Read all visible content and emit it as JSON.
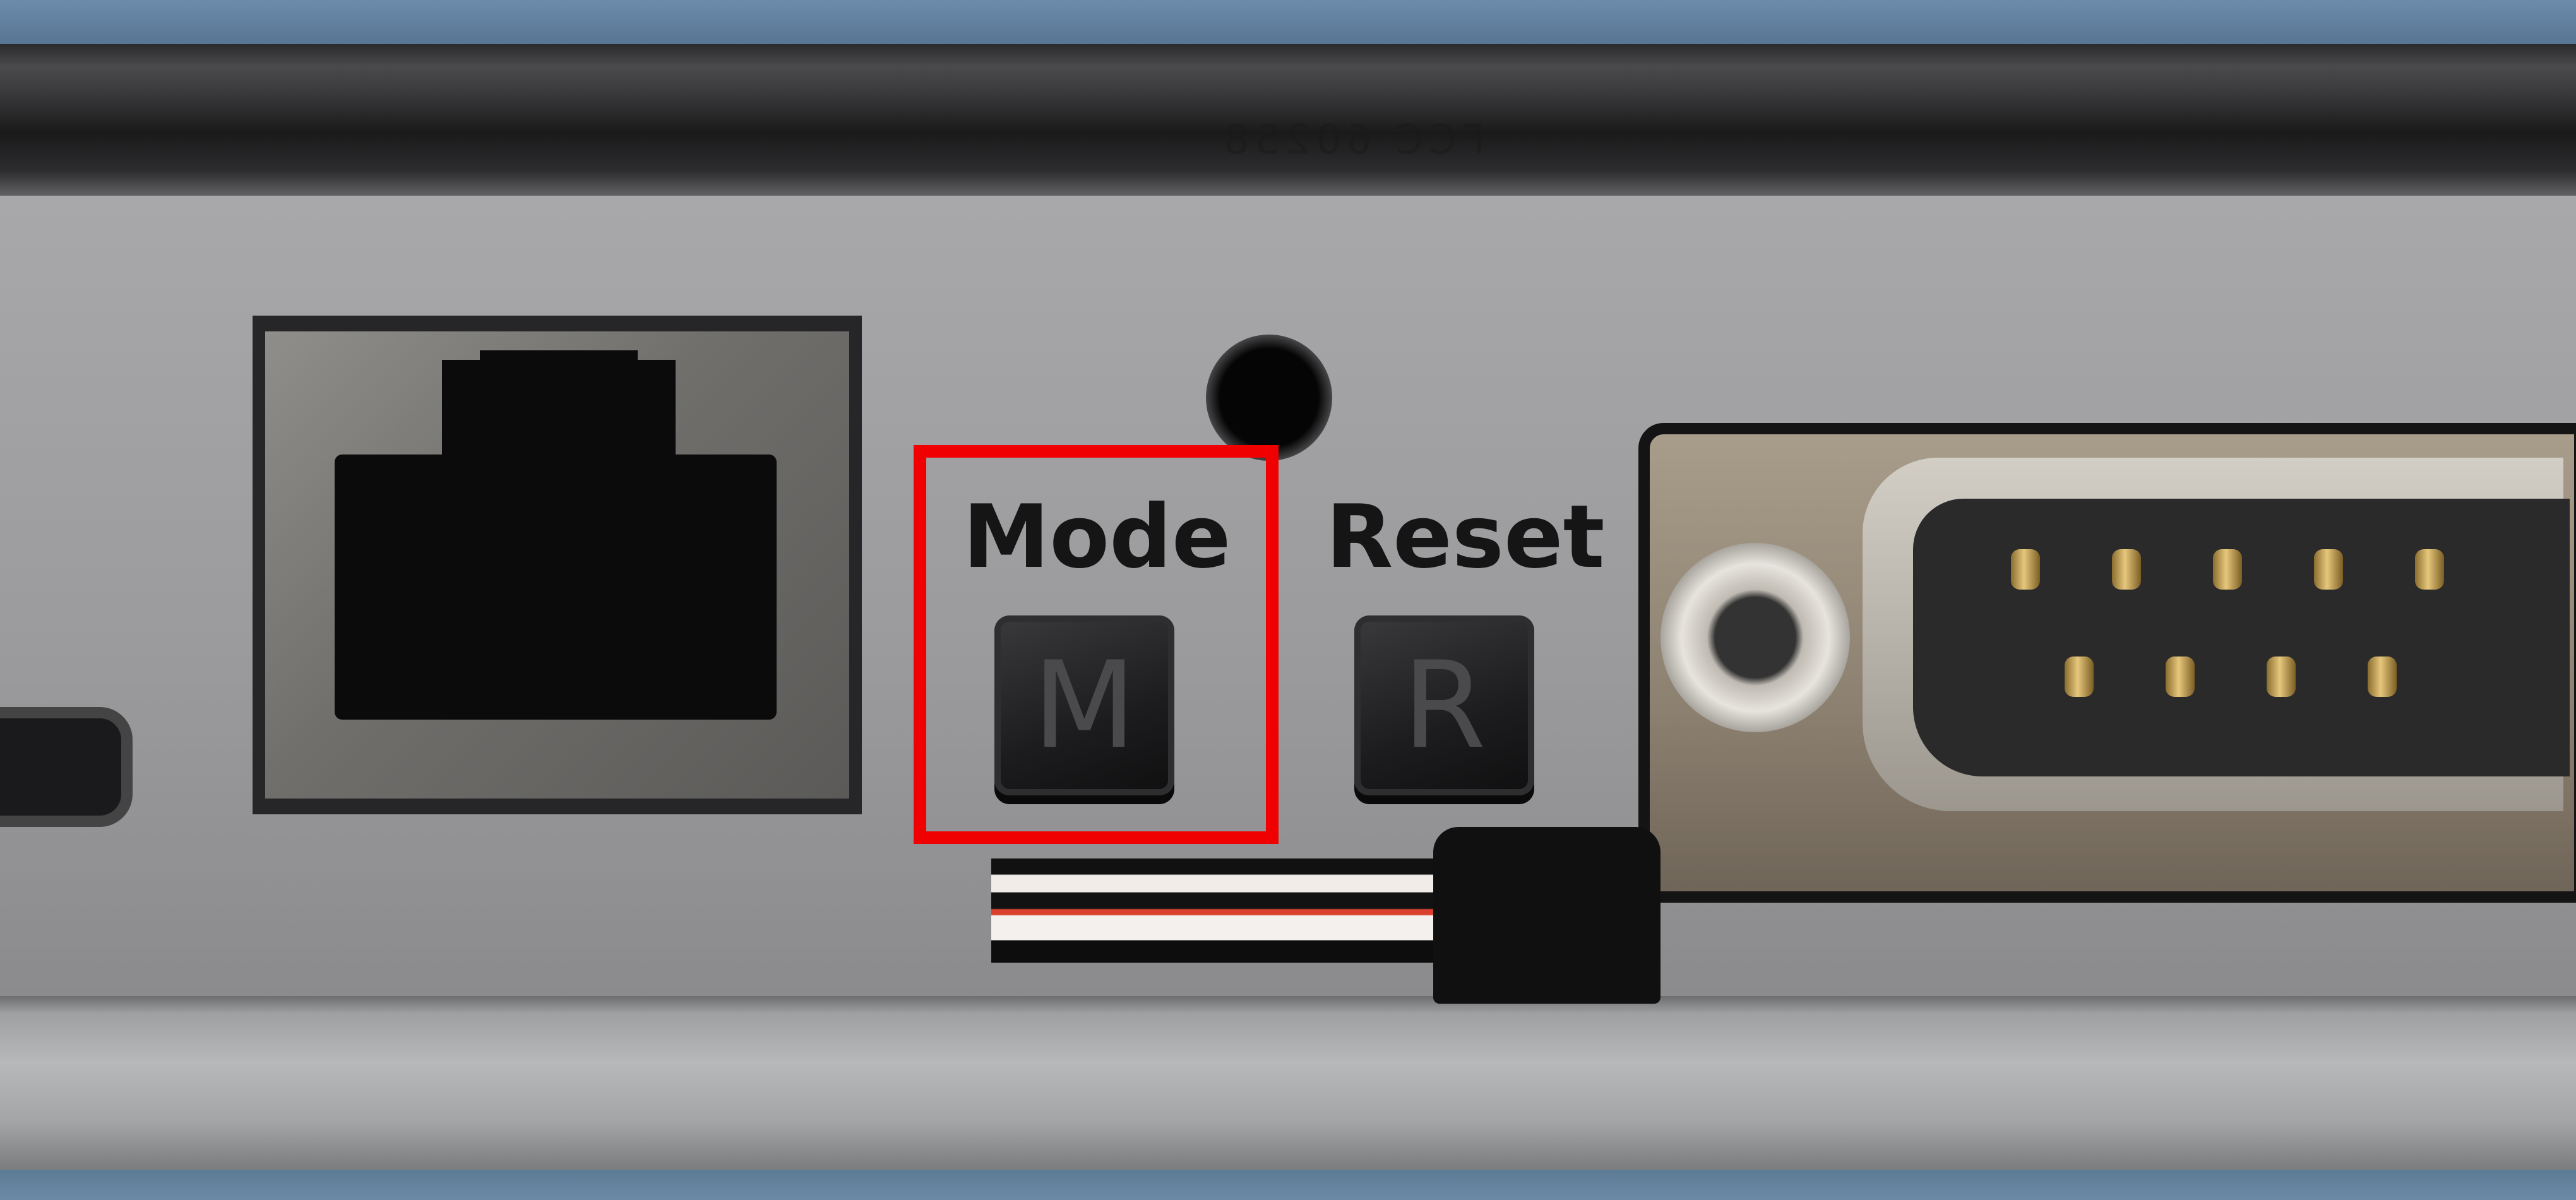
{
  "scene": "device rear panel photo",
  "labels": {
    "mode": "Mode",
    "reset": "Reset"
  },
  "buttons": {
    "mode_glyph": "M",
    "reset_glyph": "R"
  },
  "panel": {
    "mirrored_text": "FCC 60258"
  },
  "highlight": {
    "color": "#f00000"
  }
}
